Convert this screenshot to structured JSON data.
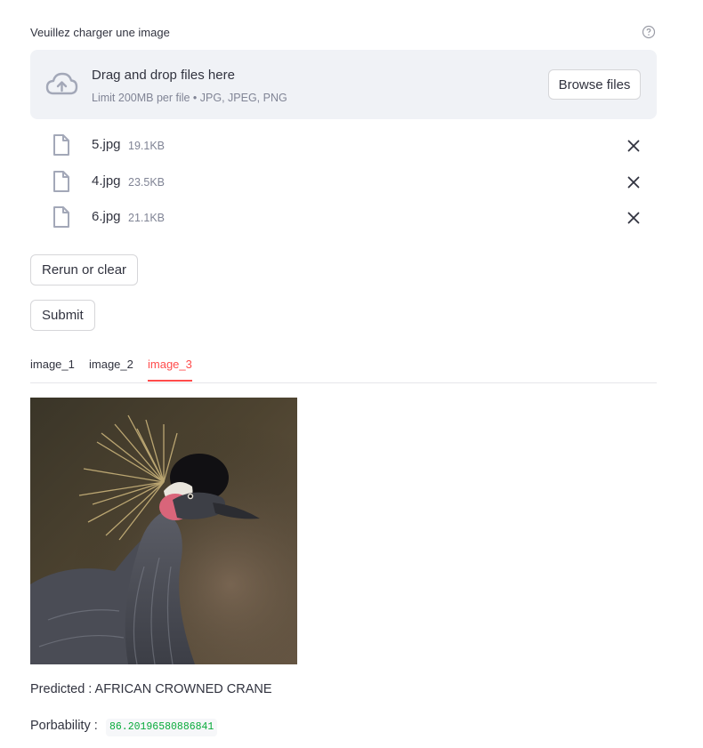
{
  "uploader": {
    "label": "Veuillez charger une image",
    "help_icon": "question-circle-icon",
    "dropzone": {
      "icon": "cloud-upload-icon",
      "title": "Drag and drop files here",
      "limit": "Limit 200MB per file • JPG, JPEG, PNG",
      "browse_label": "Browse files"
    },
    "files": [
      {
        "name": "5.jpg",
        "size": "19.1KB"
      },
      {
        "name": "4.jpg",
        "size": "23.5KB"
      },
      {
        "name": "6.jpg",
        "size": "21.1KB"
      }
    ]
  },
  "buttons": {
    "rerun_label": "Rerun or clear",
    "submit_label": "Submit"
  },
  "tabs": [
    {
      "label": "image_1",
      "active": false
    },
    {
      "label": "image_2",
      "active": false
    },
    {
      "label": "image_3",
      "active": true
    }
  ],
  "result": {
    "predicted": "Predicted : AFRICAN CROWNED CRANE",
    "probability_label": "Porbability :",
    "probability_value": "86.20196580886841"
  },
  "colors": {
    "accent": "#ff4b4b",
    "text": "#31333f",
    "muted": "#808495",
    "dropzone_bg": "#f0f2f6",
    "code_green": "#09ab3b"
  }
}
